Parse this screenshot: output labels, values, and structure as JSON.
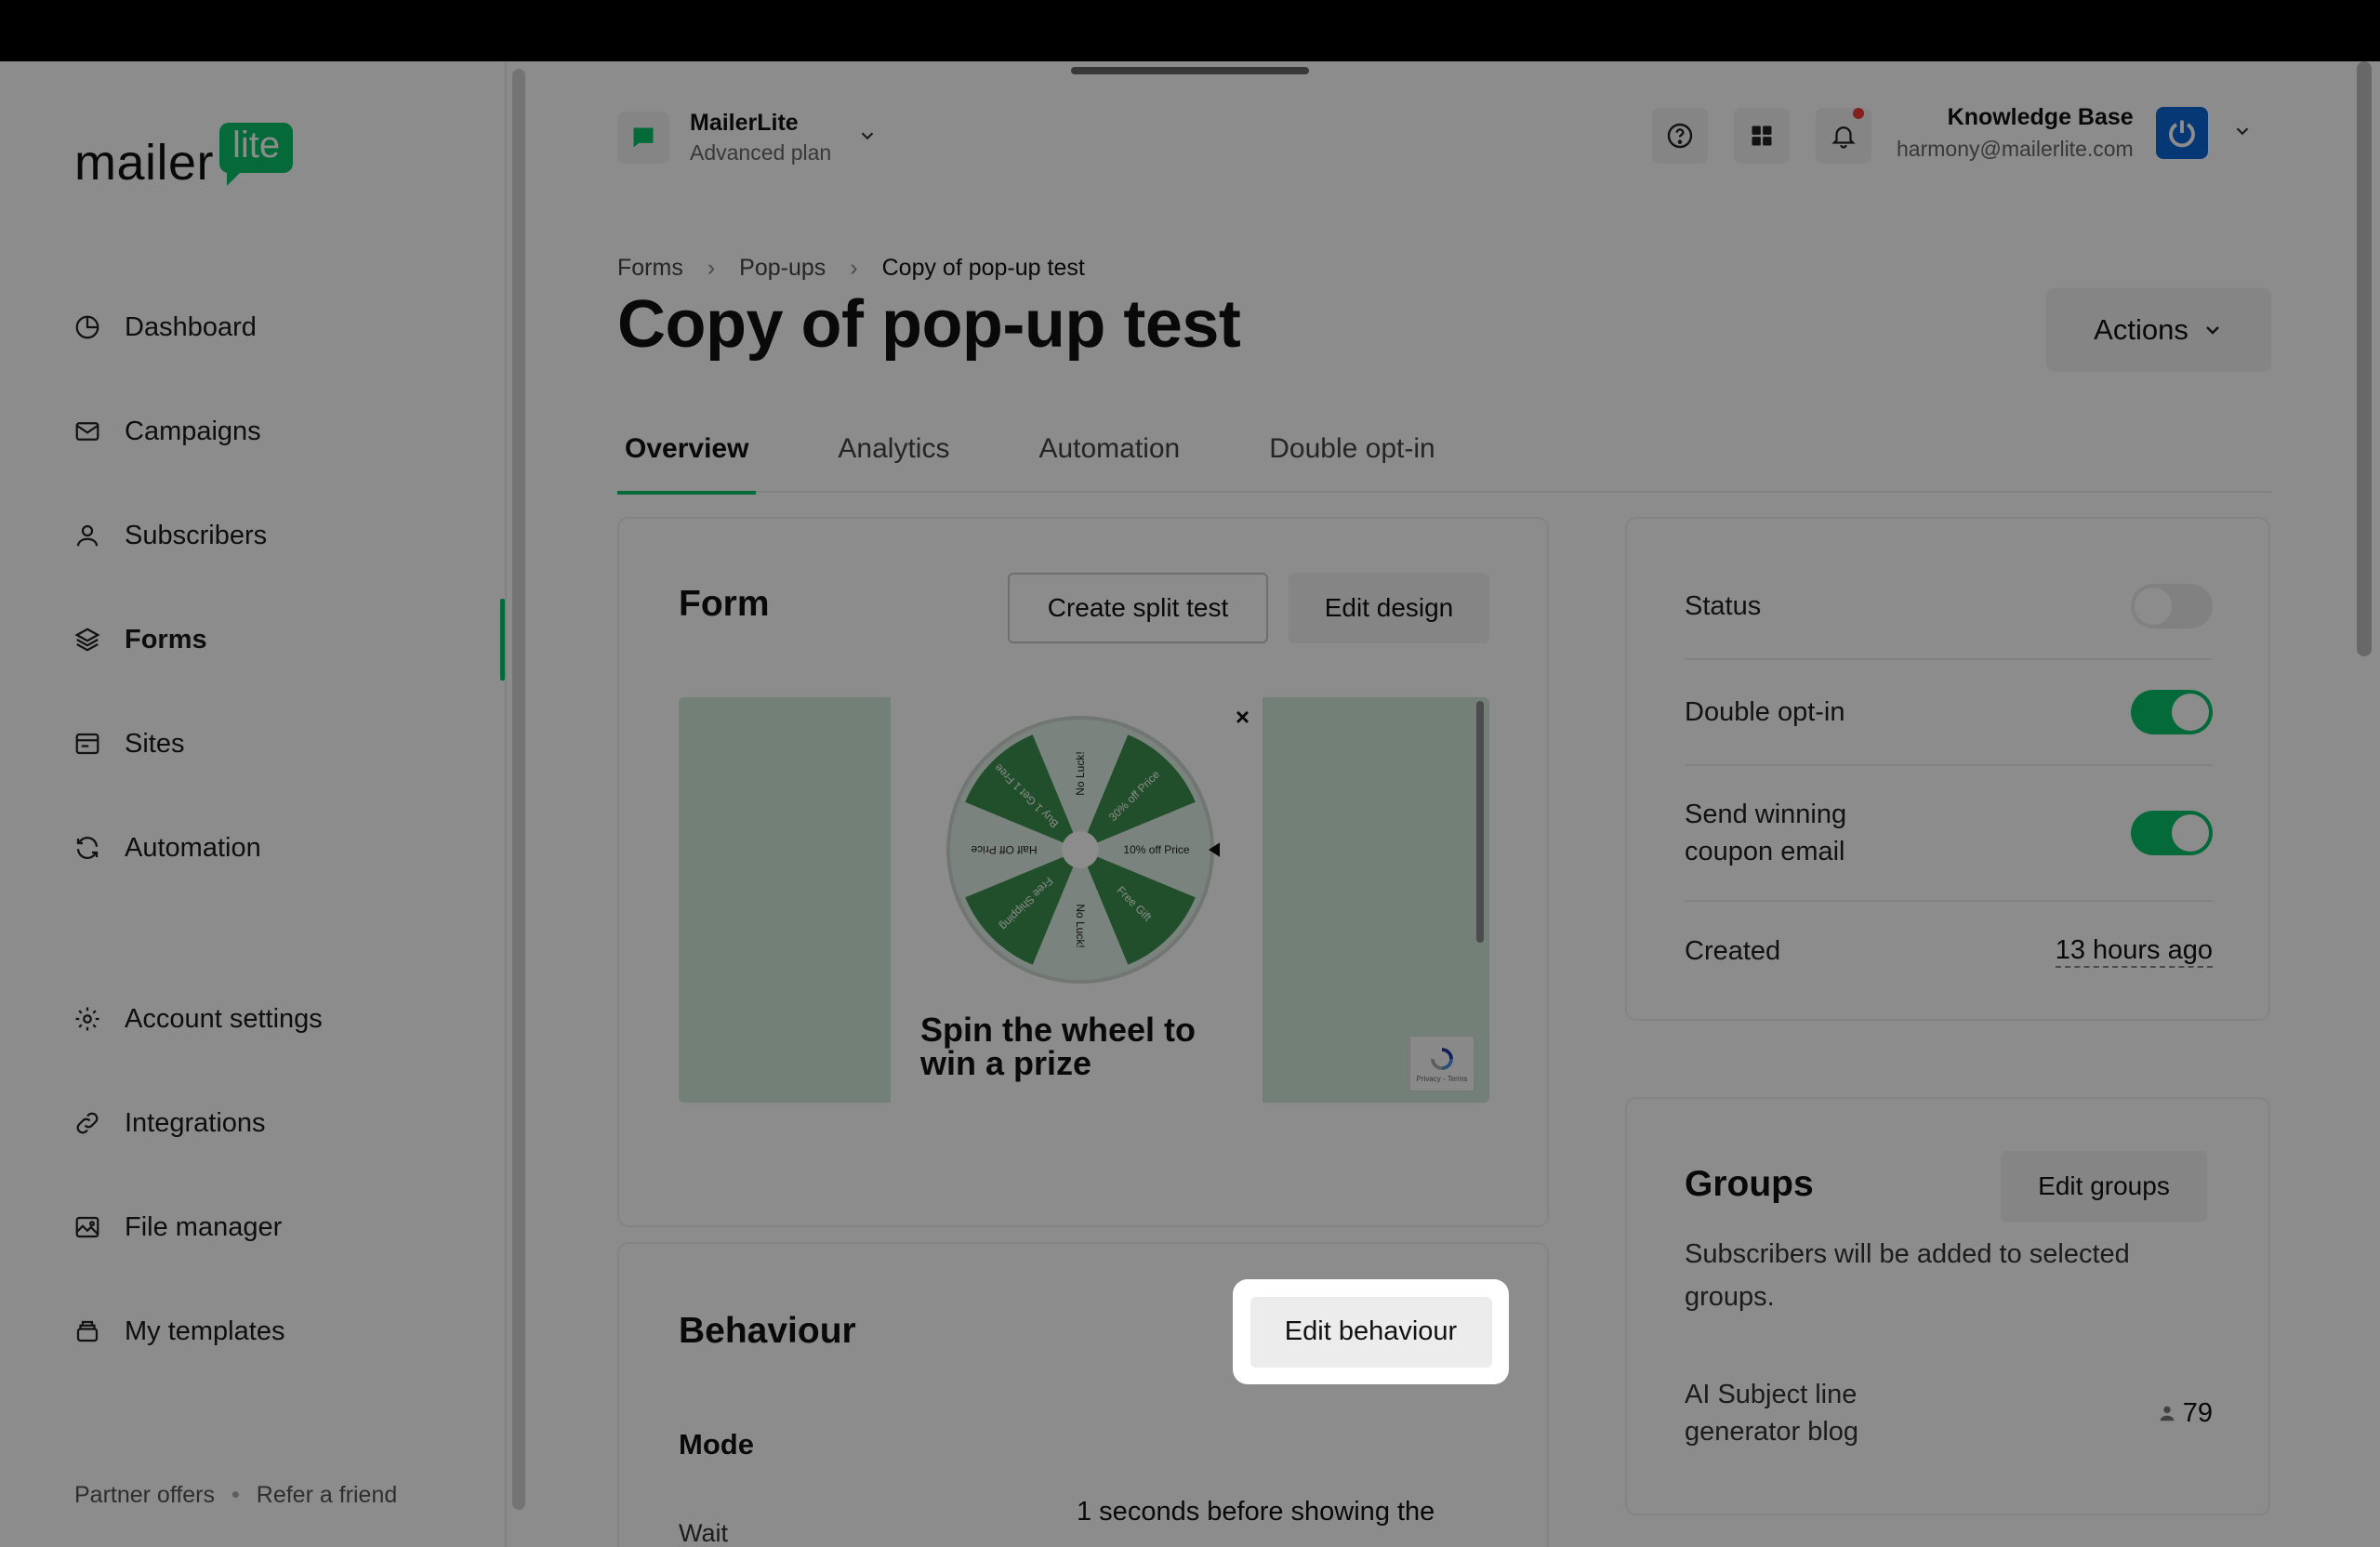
{
  "app": {
    "logo_text": "mailer",
    "logo_badge": "lite"
  },
  "sidebar": {
    "items": [
      {
        "label": "Dashboard",
        "icon": "clock-pie-icon"
      },
      {
        "label": "Campaigns",
        "icon": "envelope-icon"
      },
      {
        "label": "Subscribers",
        "icon": "person-icon"
      },
      {
        "label": "Forms",
        "icon": "layers-icon",
        "active": true
      },
      {
        "label": "Sites",
        "icon": "browser-icon"
      },
      {
        "label": "Automation",
        "icon": "refresh-icon"
      },
      {
        "label": "Account settings",
        "icon": "gear-icon"
      },
      {
        "label": "Integrations",
        "icon": "link-icon"
      },
      {
        "label": "File manager",
        "icon": "image-icon"
      },
      {
        "label": "My templates",
        "icon": "stack-icon"
      }
    ],
    "footer": {
      "partner_offers": "Partner offers",
      "refer_friend": "Refer a friend",
      "separator": "•"
    }
  },
  "header": {
    "account_name": "MailerLite",
    "account_plan": "Advanced plan",
    "user_name": "Knowledge Base",
    "user_email": "harmony@mailerlite.com"
  },
  "breadcrumb": {
    "items": [
      "Forms",
      "Pop-ups",
      "Copy of pop-up test"
    ],
    "separator": "›"
  },
  "page": {
    "title": "Copy of pop-up test",
    "actions_label": "Actions"
  },
  "tabs": [
    "Overview",
    "Analytics",
    "Automation",
    "Double opt-in"
  ],
  "form_card": {
    "title": "Form",
    "split_test_label": "Create split test",
    "edit_design_label": "Edit design",
    "preview": {
      "close": "×",
      "headline": "Spin the wheel to win a prize",
      "wheel_segments": [
        "No Luck!",
        "30% off Price",
        "10% off Price",
        "Free Gift",
        "No Luck!",
        "Free Shipping",
        "Half Off Price",
        "Buy 1 Get 1 Free"
      ],
      "recaptcha_text": "Privacy - Terms"
    }
  },
  "behaviour_card": {
    "title": "Behaviour",
    "edit_label": "Edit behaviour",
    "mode_title": "Mode",
    "wait_label": "Wait",
    "wait_value": "1 seconds before showing the"
  },
  "status_card": {
    "status_label": "Status",
    "status_on": false,
    "double_optin_label": "Double opt-in",
    "double_optin_on": true,
    "coupon_label": "Send winning coupon email",
    "coupon_on": true,
    "created_label": "Created",
    "created_value": "13 hours ago"
  },
  "groups_card": {
    "title": "Groups",
    "edit_label": "Edit groups",
    "description": "Subscribers will be added to selected groups.",
    "groups": [
      {
        "name": "AI Subject line generator blog",
        "count": "79"
      }
    ]
  },
  "colors": {
    "brand_green": "#09c269",
    "wheel_green": "#3c8f4f",
    "avatar_blue": "#0b66d6"
  }
}
